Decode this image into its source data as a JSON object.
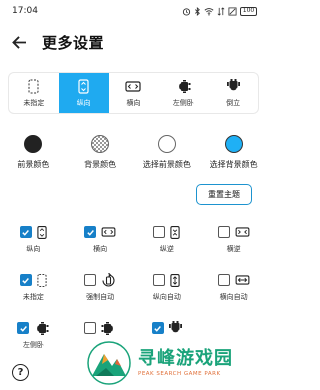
{
  "status_bar": {
    "time": "17:04",
    "battery": "100",
    "icons": [
      "alarm-icon",
      "bluetooth-icon",
      "wifi-icon",
      "data-icon",
      "mute-icon",
      "battery-icon"
    ]
  },
  "app_bar": {
    "title": "更多设置",
    "back_icon": "arrow-left-icon"
  },
  "orientation_bar": {
    "items": [
      {
        "label": "未指定",
        "icon": "phone-dashed-icon",
        "active": false
      },
      {
        "label": "纵向",
        "icon": "phone-portrait-icon",
        "active": true
      },
      {
        "label": "横向",
        "icon": "phone-landscape-icon",
        "active": false
      },
      {
        "label": "左侧卧",
        "icon": "android-left-icon",
        "active": false
      },
      {
        "label": "倒立",
        "icon": "android-upside-icon",
        "active": false
      }
    ],
    "active_color": "#1faaf0"
  },
  "colors": {
    "items": [
      {
        "label": "前景颜色",
        "color": "#222222"
      },
      {
        "label": "背景颜色",
        "color": "checkered"
      },
      {
        "label": "选择前景颜色",
        "color": "#ffffff"
      },
      {
        "label": "选择背景颜色",
        "color": "#1fb0f5"
      }
    ]
  },
  "reset_button": {
    "label": "重置主题"
  },
  "orientation_options": {
    "rows": [
      [
        {
          "label": "纵向",
          "checked": true,
          "icon": "phone-portrait-icon"
        },
        {
          "label": "横向",
          "checked": true,
          "icon": "phone-landscape-icon"
        },
        {
          "label": "纵逆",
          "checked": false,
          "icon": "phone-portrait-reverse-icon"
        },
        {
          "label": "横逆",
          "checked": false,
          "icon": "phone-landscape-reverse-icon"
        }
      ],
      [
        {
          "label": "未指定",
          "checked": true,
          "icon": "phone-dashed-icon"
        },
        {
          "label": "强制自动",
          "checked": false,
          "icon": "rotate-force-icon"
        },
        {
          "label": "纵向自动",
          "checked": false,
          "icon": "phone-portrait-auto-icon"
        },
        {
          "label": "横向自动",
          "checked": false,
          "icon": "phone-landscape-auto-icon"
        }
      ],
      [
        {
          "label": "左侧卧",
          "checked": true,
          "icon": "android-left-icon"
        },
        {
          "label": "",
          "checked": false,
          "icon": "android-right-icon"
        },
        {
          "label": "",
          "checked": true,
          "icon": "android-upside-icon"
        },
        {
          "label": "",
          "checked": false,
          "icon": ""
        }
      ]
    ],
    "checked_color": "#1780c8"
  },
  "help_icon": "help-circle-icon",
  "watermark": {
    "title": "寻峰游戏园",
    "subtitle": "PEAK SEARCH GAME PARK"
  }
}
